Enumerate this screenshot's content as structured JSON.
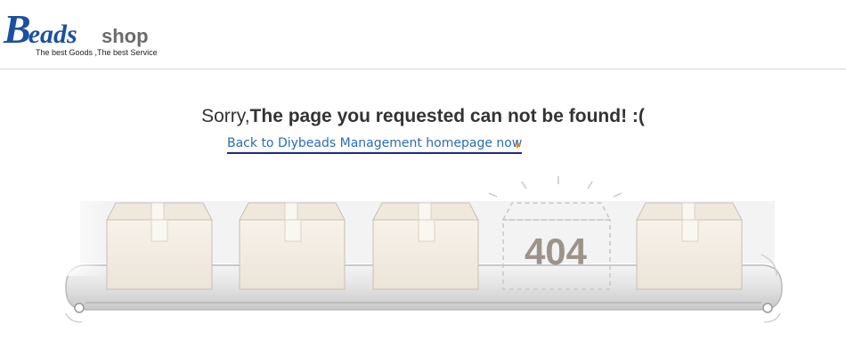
{
  "header": {
    "logo": {
      "letter_b": "B",
      "letters_eads": "eads",
      "shop": "shop",
      "tagline": "The best Goods ,The best Service"
    }
  },
  "message": {
    "sorry": "Sorry,",
    "text": "The page you requested can not be found! :(",
    "back_link": "Back to Diybeads Management homepage now"
  },
  "scene": {
    "error_code": "404"
  },
  "colors": {
    "brand_blue": "#1d4fa0",
    "link_blue": "#2a6db3",
    "accent_orange": "#e08a1e",
    "box_fill": "#f2ece4",
    "error_text": "#9c948a"
  },
  "icons": {
    "link_arrow": "caret-right-icon"
  }
}
